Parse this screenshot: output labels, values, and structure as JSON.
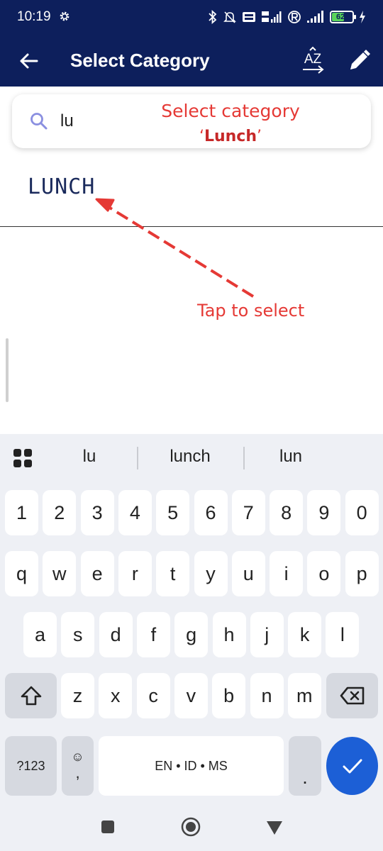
{
  "status_bar": {
    "time": "10:19",
    "battery": "62",
    "battery_level": 0.62
  },
  "app_bar": {
    "title": "Select Category",
    "sort_label": "AZ"
  },
  "search": {
    "value": "lu",
    "placeholder": ""
  },
  "results": [
    {
      "label": "LUNCH"
    }
  ],
  "annotations": {
    "select_title": "Select category",
    "select_quote_open": "‘",
    "select_name": "Lunch",
    "select_quote_close": "’",
    "tap_hint": "Tap to select"
  },
  "keyboard": {
    "suggestions": [
      "lu",
      "lunch",
      "lun"
    ],
    "rows": {
      "numbers": [
        "1",
        "2",
        "3",
        "4",
        "5",
        "6",
        "7",
        "8",
        "9",
        "0"
      ],
      "row1": [
        "q",
        "w",
        "e",
        "r",
        "t",
        "y",
        "u",
        "i",
        "o",
        "p"
      ],
      "row2": [
        "a",
        "s",
        "d",
        "f",
        "g",
        "h",
        "j",
        "k",
        "l"
      ],
      "row3": [
        "z",
        "x",
        "c",
        "v",
        "b",
        "n",
        "m"
      ]
    },
    "symbols_key": "?123",
    "emoji_key": "☺",
    "comma_key": ",",
    "space_label": "EN • ID • MS",
    "period_key": "."
  },
  "colors": {
    "header": "#0d1f5c",
    "annotation": "#e53935",
    "enter_key": "#1c5fd6"
  }
}
